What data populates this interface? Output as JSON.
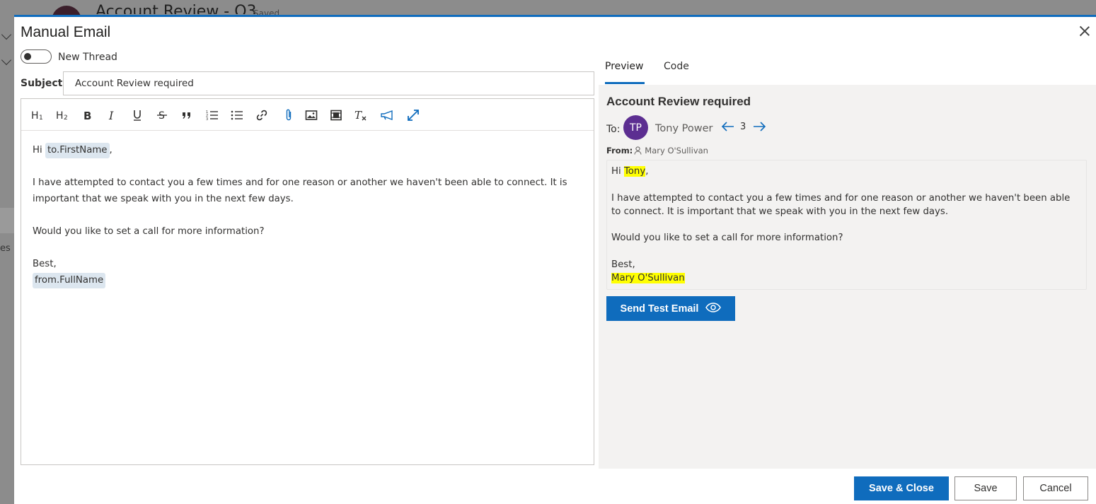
{
  "background": {
    "title": "Account Review - Q3",
    "saved": "Saved",
    "partial_text": "es"
  },
  "dialog": {
    "title": "Manual Email",
    "new_thread_label": "New Thread",
    "new_thread_on": false,
    "subject_label": "Subject",
    "subject_value": "Account Review required"
  },
  "toolbar": {
    "items": [
      "heading-1",
      "heading-2",
      "bold",
      "italic",
      "underline",
      "strikethrough",
      "quote",
      "numbered-list",
      "bulleted-list",
      "link",
      "attachment",
      "image",
      "video",
      "clear-formatting",
      "megaphone",
      "expand"
    ]
  },
  "editor": {
    "greeting": "Hi",
    "to_token": "to.FirstName",
    "comma": ",",
    "paragraph1": "I have attempted to contact you a few times and for one reason or another we haven't been able to connect. It is important that we speak with you in the next few days.",
    "paragraph2": "Would you like to set a call for more information?",
    "signoff": "Best,",
    "from_token": "from.FullName"
  },
  "tabs": {
    "preview": "Preview",
    "code": "Code",
    "active": "preview"
  },
  "preview": {
    "subject": "Account Review required",
    "to_label": "To:",
    "recipient_initials": "TP",
    "recipient_name": "Tony Power",
    "recipient_index": "3",
    "from_label": "From:",
    "sender_name": "Mary O'Sullivan",
    "greeting": "Hi",
    "first_name": "Tony",
    "comma": ",",
    "paragraph1": "I have attempted to contact you a few times and for one reason or another we haven't been able to connect. It is important that we speak with you in the next few days.",
    "paragraph2": "Would you like to set a call for more information?",
    "signoff": "Best,",
    "signature": "Mary O'Sullivan",
    "send_test_label": "Send Test Email"
  },
  "footer": {
    "save_close": "Save & Close",
    "save": "Save",
    "cancel": "Cancel"
  },
  "colors": {
    "accent": "#0f6cbd",
    "avatar": "#5c2e91",
    "highlight": "#ffff00",
    "token_bg": "#dce6ef"
  }
}
